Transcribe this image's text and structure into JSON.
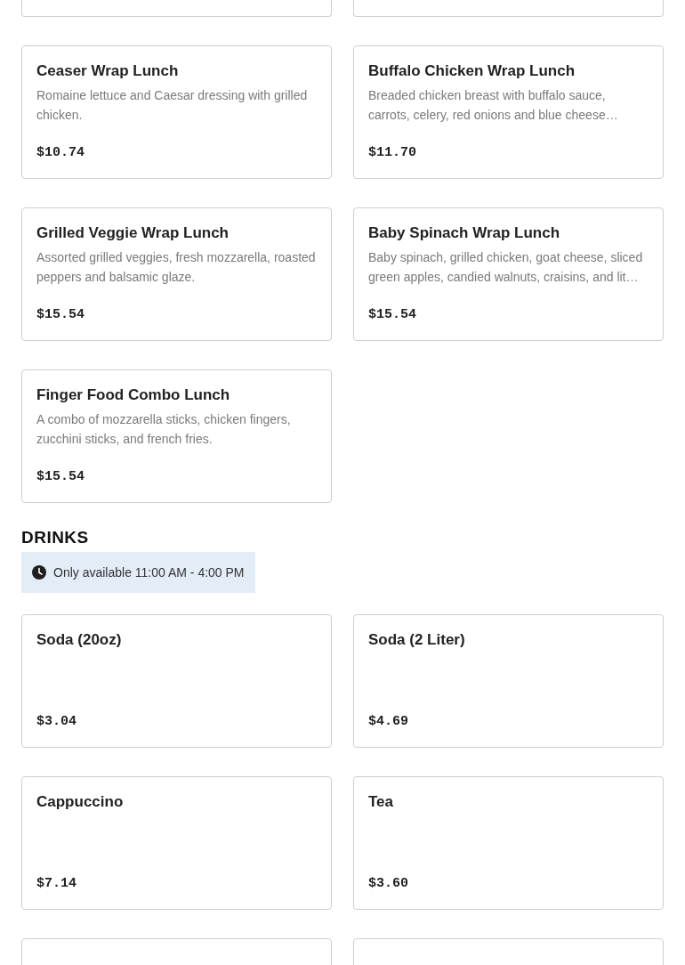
{
  "sections": [
    {
      "items": [
        {
          "name": "Ceaser Wrap Lunch",
          "description": "Romaine lettuce and Caesar dressing with grilled chicken.",
          "price": "$10.74"
        },
        {
          "name": "Buffalo Chicken Wrap Lunch",
          "description": "Breaded chicken breast with buffalo sauce, carrots, celery, red onions and blue cheese…",
          "price": "$11.70"
        },
        {
          "name": "Grilled Veggie Wrap Lunch",
          "description": "Assorted grilled veggies, fresh mozzarella, roasted peppers and balsamic glaze.",
          "price": "$15.54"
        },
        {
          "name": "Baby Spinach Wrap Lunch",
          "description": "Baby spinach, grilled chicken, goat cheese, sliced green apples, candied walnuts, craisins, and lit…",
          "price": "$15.54"
        },
        {
          "name": "Finger Food Combo Lunch",
          "description": "A combo of mozzarella sticks, chicken fingers, zucchini sticks, and french fries.",
          "price": "$15.54"
        }
      ]
    },
    {
      "title": "DRINKS",
      "availability": "Only available 11:00 AM - 4:00 PM",
      "items": [
        {
          "name": "Soda (20oz)",
          "price": "$3.04"
        },
        {
          "name": "Soda (2 Liter)",
          "price": "$4.69"
        },
        {
          "name": "Cappuccino",
          "price": "$7.14"
        },
        {
          "name": "Tea",
          "price": "$3.60"
        }
      ]
    }
  ]
}
